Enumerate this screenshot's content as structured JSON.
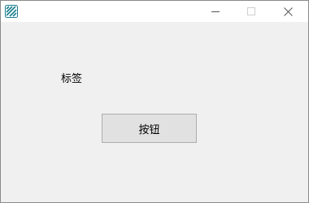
{
  "window": {
    "app_icon": "app-logo-icon",
    "caption_buttons": {
      "minimize_icon": "minimize-icon",
      "maximize_icon": "maximize-icon",
      "close_icon": "close-icon"
    }
  },
  "content": {
    "label_text": "标签",
    "button_label": "按钮"
  },
  "colors": {
    "client_background": "#f0f0f0",
    "titlebar_background": "#ffffff",
    "button_face": "#e1e1e1",
    "button_border": "#adadad",
    "app_icon_color": "#1a7f8c"
  }
}
